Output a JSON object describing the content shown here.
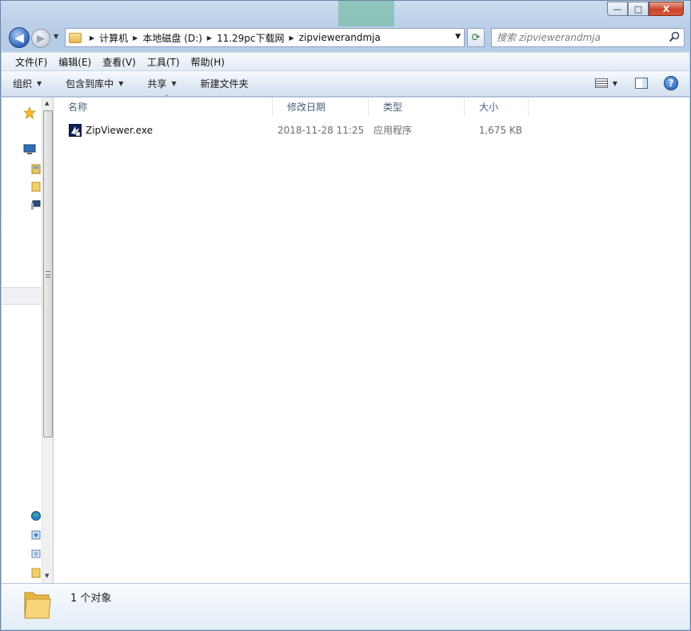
{
  "window": {
    "caption_buttons": {
      "minimize": "—",
      "maximize": "□",
      "close": "X"
    }
  },
  "navigation": {
    "back_glyph": "◀",
    "forward_glyph": "▶",
    "dropdown_glyph": "▼",
    "breadcrumbs": [
      "计算机",
      "本地磁盘 (D:)",
      "11.29pc下载网",
      "zipviewerandmja"
    ],
    "address_dropdown_glyph": "▼",
    "refresh_glyph": "⟳",
    "search_placeholder": "搜索 zipviewerandmja"
  },
  "menubar": {
    "items": [
      "文件(F)",
      "编辑(E)",
      "查看(V)",
      "工具(T)",
      "帮助(H)"
    ]
  },
  "commandbar": {
    "items": [
      {
        "label": "组织",
        "has_dropdown": true
      },
      {
        "label": "包含到库中",
        "has_dropdown": true
      },
      {
        "label": "共享",
        "has_dropdown": true
      },
      {
        "label": "新建文件夹",
        "has_dropdown": false
      }
    ],
    "dropdown_glyph": "▼",
    "help_glyph": "?"
  },
  "filelist": {
    "columns": [
      "名称",
      "修改日期",
      "类型",
      "大小"
    ],
    "sort_glyph": "^",
    "rows": [
      {
        "name": "ZipViewer.exe",
        "date": "2018-11-28 11:25",
        "type": "应用程序",
        "size": "1,675 KB"
      }
    ]
  },
  "details": {
    "item_count": "1 个对象"
  },
  "colors": {
    "accent": "#2d64b4",
    "header_text": "#4c607a",
    "muted_text": "#6d6d6d"
  }
}
